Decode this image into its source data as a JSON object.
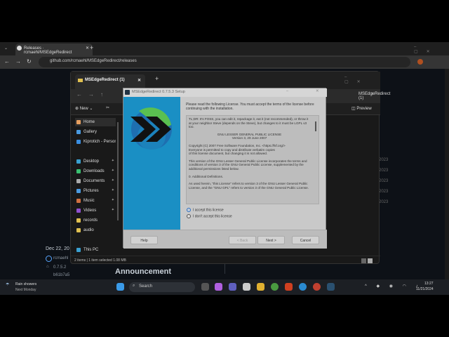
{
  "browser": {
    "tab_title": "Releases · rcmaehl/MSEdgeRedirect",
    "url": "github.com/rcmaehl/MSEdgeRedirect/releases",
    "new_tab": "+"
  },
  "github": {
    "date": "Dec 22, 20",
    "author": "rcmaehl",
    "tag": "0.7.5.2",
    "commit": "b61b7a5",
    "heading": "Announcement",
    "years": [
      "2023",
      "2023",
      "2023",
      "2023",
      "2023"
    ]
  },
  "explorer": {
    "tab_title": "MSEdgeRedirect (1)",
    "search_path": "MSEdgeRedirect (1)",
    "new_label": "New",
    "preview_label": "Preview",
    "sidebar": [
      {
        "label": "Home",
        "color": "#e8a060"
      },
      {
        "label": "Gallery",
        "color": "#4a9ae0"
      },
      {
        "label": "Kiprotich - Personal",
        "color": "#3a8ee0"
      },
      {
        "label": "Desktop",
        "color": "#3aa0d0",
        "pin": true
      },
      {
        "label": "Downloads",
        "color": "#3ac070",
        "pin": true
      },
      {
        "label": "Documents",
        "color": "#aaa",
        "pin": true
      },
      {
        "label": "Pictures",
        "color": "#4a9ae0",
        "pin": true
      },
      {
        "label": "Music",
        "color": "#d07040",
        "pin": true
      },
      {
        "label": "Videos",
        "color": "#9050d0",
        "pin": true
      },
      {
        "label": "records",
        "color": "#e0c050"
      },
      {
        "label": "audio",
        "color": "#e0c050"
      },
      {
        "label": "This PC",
        "color": "#3aa0d0"
      }
    ],
    "status": "2 items  |  1 item selected  1.08 MB"
  },
  "setup": {
    "title": "MSEdgeRedirect 0.7.5.3 Setup",
    "intro": "Please read the following License. You must accept the terms of the license before continuing with the installation.",
    "license": [
      "TL;DR: It's FOSS, you can edit it, repackage it, eat it (not recommended), or throw it at your neighbor Steve (depends on the Steve), but changes to it must be LGPL v3 too.",
      "GNU LESSER GENERAL PUBLIC LICENSE\nVersion 3, 29 June 2007",
      "Copyright (C) 2007 Free Software Foundation, Inc. <https://fsf.org/>\nEveryone is permitted to copy and distribute verbatim copies\nof this license document, but changing it is not allowed.",
      "This version of the GNU Lesser General Public License incorporates the terms and conditions of version 3 of the GNU General Public License, supplemented by the additional permissions listed below.",
      "0. Additional Definitions.",
      "As used herein, \"this License\" refers to version 3 of the GNU Lesser General Public License, and the \"GNU GPL\" refers to version 3 of the GNU General Public License."
    ],
    "accept": "I accept this license",
    "decline": "I don't accept this license",
    "selected": "accept",
    "help": "Help",
    "back": "< Back",
    "next": "Next >",
    "cancel": "Cancel"
  },
  "taskbar": {
    "weather_title": "Rain showers",
    "weather_sub": "Next Monday",
    "search": "Search",
    "time": "13:27",
    "date": "11/21/2024"
  }
}
